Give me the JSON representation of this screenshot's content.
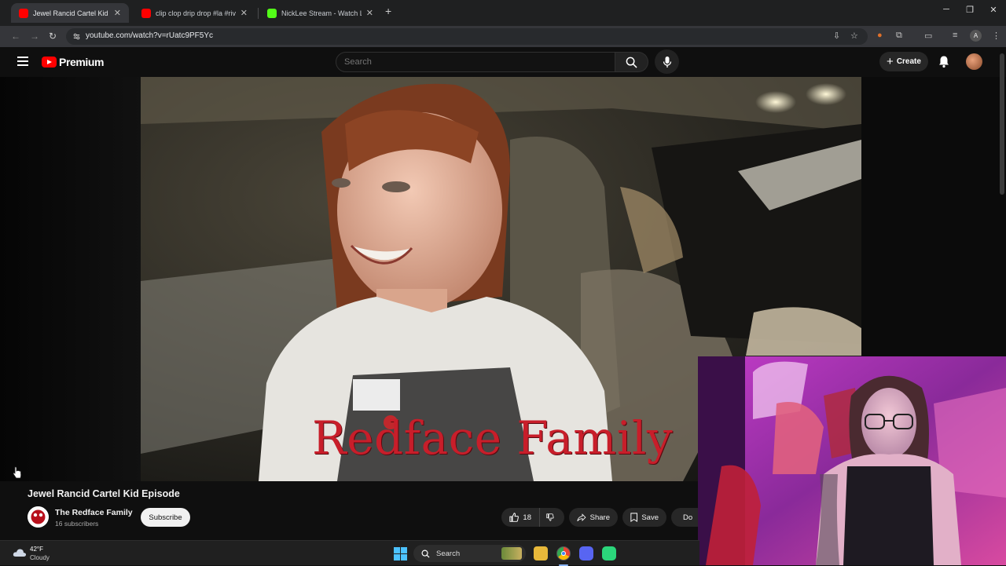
{
  "browser": {
    "tabs": [
      {
        "label": "Jewel Rancid Cartel Kid Episo",
        "color": "#ff0000",
        "active": true
      },
      {
        "label": "clip clop drip drop #la #riversid",
        "color": "#ff0000",
        "active": false
      },
      {
        "label": "NickLee Stream - Watch Live o",
        "color": "#53fc18",
        "active": false
      }
    ],
    "new_tab": "+",
    "url": "youtube.com/watch?v=rUatc9PF5Yc",
    "profile_initial": "A"
  },
  "youtube": {
    "logo_text": "Premium",
    "search_placeholder": "Search",
    "create_label": "Create",
    "video": {
      "overlay_text": "Redface Family",
      "title": "Jewel Rancid Cartel Kid Episode"
    },
    "channel": {
      "name": "The Redface Family",
      "subscribers": "16 subscribers",
      "subscribe_label": "Subscribe"
    },
    "actions": {
      "like_count": "18",
      "share_label": "Share",
      "save_label": "Save",
      "download_label": "Do"
    }
  },
  "taskbar": {
    "temperature": "42°F",
    "condition": "Cloudy",
    "search_label": "Search"
  },
  "colors": {
    "yt_red": "#ff0000",
    "bg": "#0f0f0f",
    "win_blue": "#4cc2ff"
  },
  "icons": [
    "youtube-favicon",
    "kick-favicon",
    "hamburger-icon",
    "search-icon",
    "mic-icon",
    "bell-icon",
    "like-icon",
    "dislike-icon",
    "share-icon",
    "save-icon",
    "download-icon",
    "weather-cloud-icon",
    "windows-start-icon"
  ]
}
